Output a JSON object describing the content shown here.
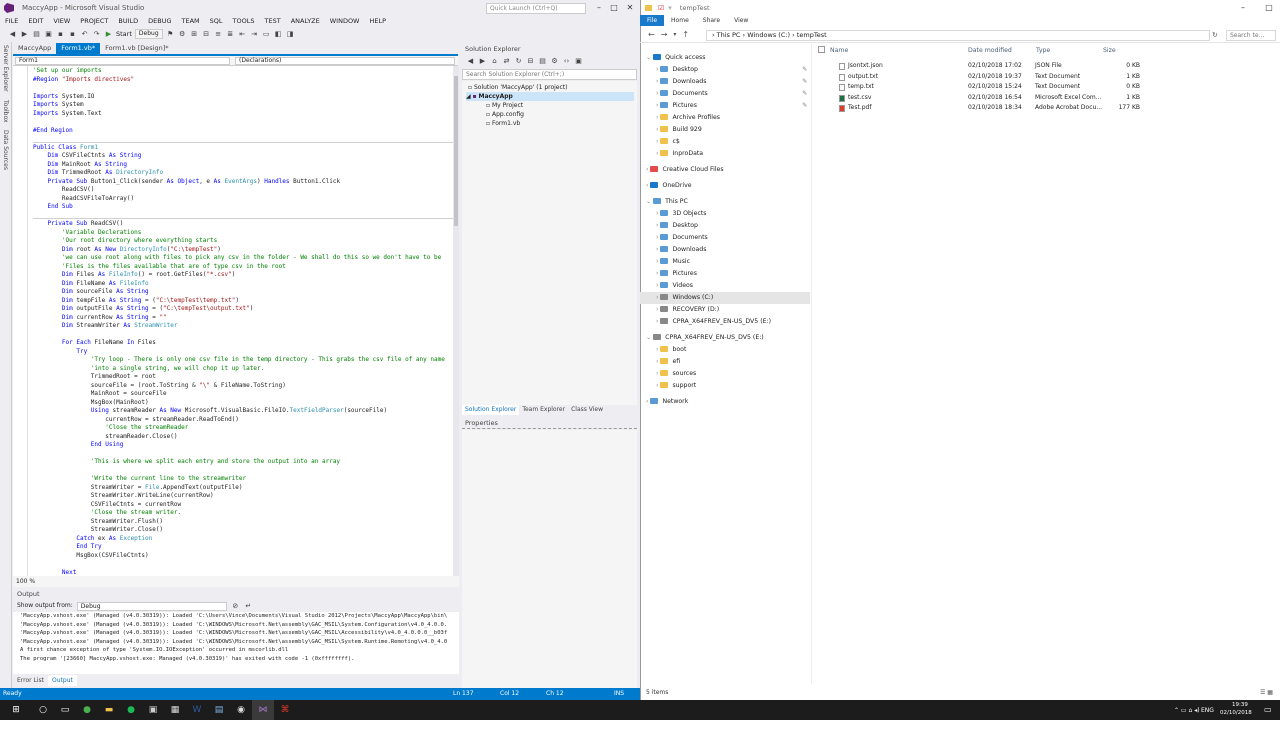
{
  "vs": {
    "title": "MaccyApp - Microsoft Visual Studio",
    "quick_launch_placeholder": "Quick Launch (Ctrl+Q)",
    "menu": [
      "FILE",
      "EDIT",
      "VIEW",
      "PROJECT",
      "BUILD",
      "DEBUG",
      "TEAM",
      "SQL",
      "TOOLS",
      "TEST",
      "ANALYZE",
      "WINDOW",
      "HELP"
    ],
    "toolbar": {
      "start": "Start",
      "config": "Debug"
    },
    "side_tabs": [
      "Server Explorer",
      "Toolbox",
      "Data Sources"
    ],
    "doc_tabs": [
      "MaccyApp",
      "Form1.vb*",
      "Form1.vb [Design]*"
    ],
    "nav_left": "Form1",
    "nav_right": "(Declarations)",
    "zoom": "100 %",
    "output": {
      "title": "Output",
      "show_from_label": "Show output from:",
      "show_from_value": "Debug",
      "lines": [
        "'MaccyApp.vshost.exe' (Managed (v4.0.30319)): Loaded 'C:\\Users\\Vince\\Documents\\Visual Studio 2012\\Projects\\MaccyApp\\MaccyApp\\bin\\",
        "'MaccyApp.vshost.exe' (Managed (v4.0.30319)): Loaded 'C:\\WINDOWS\\Microsoft.Net\\assembly\\GAC_MSIL\\System.Configuration\\v4.0_4.0.0.",
        "'MaccyApp.vshost.exe' (Managed (v4.0.30319)): Loaded 'C:\\WINDOWS\\Microsoft.Net\\assembly\\GAC_MSIL\\Accessibility\\v4.0_4.0.0.0__b03f",
        "'MaccyApp.vshost.exe' (Managed (v4.0.30319)): Loaded 'C:\\WINDOWS\\Microsoft.Net\\assembly\\GAC_MSIL\\System.Runtime.Remoting\\v4.0_4.0",
        "A first chance exception of type 'System.IO.IOException' occurred in mscorlib.dll",
        "The program '[23660] MaccyApp.vshost.exe: Managed (v4.0.30319)' has exited with code -1 (0xffffffff)."
      ]
    },
    "bottom_tabs": [
      "Error List",
      "Output"
    ],
    "solution_explorer": {
      "title": "Solution Explorer",
      "search_placeholder": "Search Solution Explorer (Ctrl+;)",
      "items": [
        "Solution 'MaccyApp' (1 project)",
        "MaccyApp",
        "My Project",
        "App.config",
        "Form1.vb"
      ],
      "tabs": [
        "Solution Explorer",
        "Team Explorer",
        "Class View"
      ]
    },
    "properties_title": "Properties",
    "status": {
      "ready": "Ready",
      "ln": "Ln 137",
      "col": "Col 12",
      "ch": "Ch 12",
      "ins": "INS"
    }
  },
  "code": [
    [
      [
        "cm",
        "'Set up our imports"
      ]
    ],
    [
      [
        "kw",
        "#Region "
      ],
      [
        "st",
        "\"Imports directives\""
      ]
    ],
    [],
    [
      [
        "kw",
        "Imports "
      ],
      [
        "",
        "System.IO"
      ]
    ],
    [
      [
        "kw",
        "Imports "
      ],
      [
        "",
        "System"
      ]
    ],
    [
      [
        "kw",
        "Imports "
      ],
      [
        "",
        "System.Text"
      ]
    ],
    [],
    [
      [
        "kw",
        "#End Region"
      ]
    ],
    [],
    [
      [
        "kw",
        "Public Class "
      ],
      [
        "ty",
        "Form1"
      ]
    ],
    [
      [
        "",
        "    "
      ],
      [
        "kw",
        "Dim "
      ],
      [
        "",
        "CSVFileCtnts "
      ],
      [
        "kw",
        "As String"
      ]
    ],
    [
      [
        "",
        "    "
      ],
      [
        "kw",
        "Dim "
      ],
      [
        "",
        "MainRoot "
      ],
      [
        "kw",
        "As String"
      ]
    ],
    [
      [
        "",
        "    "
      ],
      [
        "kw",
        "Dim "
      ],
      [
        "",
        "TrimmedRoot "
      ],
      [
        "kw",
        "As "
      ],
      [
        "ty",
        "DirectoryInfo"
      ]
    ],
    [
      [
        "",
        "    "
      ],
      [
        "kw",
        "Private Sub "
      ],
      [
        "",
        "Button1_Click(sender "
      ],
      [
        "kw",
        "As Object"
      ],
      [
        "",
        ", e "
      ],
      [
        "kw",
        "As "
      ],
      [
        "ty",
        "EventArgs"
      ],
      [
        "",
        ") "
      ],
      [
        "kw",
        "Handles "
      ],
      [
        "",
        "Button1.Click"
      ]
    ],
    [
      [
        "",
        "        ReadCSV()"
      ]
    ],
    [
      [
        "",
        "        ReadCSVFileToArray()"
      ]
    ],
    [
      [
        "",
        "    "
      ],
      [
        "kw",
        "End Sub"
      ]
    ],
    [],
    [
      [
        "",
        "    "
      ],
      [
        "kw",
        "Private Sub "
      ],
      [
        "",
        "ReadCSV()"
      ]
    ],
    [
      [
        "",
        "        "
      ],
      [
        "cm",
        "'Variable Declerations"
      ]
    ],
    [
      [
        "",
        "        "
      ],
      [
        "cm",
        "'Our root directory where everything starts"
      ]
    ],
    [
      [
        "",
        "        "
      ],
      [
        "kw",
        "Dim "
      ],
      [
        "",
        "root "
      ],
      [
        "kw",
        "As New "
      ],
      [
        "ty",
        "DirectoryInfo"
      ],
      [
        "",
        "("
      ],
      [
        "st",
        "\"C:\\tempTest\""
      ],
      [
        "",
        ")"
      ]
    ],
    [
      [
        "",
        "        "
      ],
      [
        "cm",
        "'we can use root along with files to pick any csv in the folder - We shall do this so we don't have to be"
      ]
    ],
    [
      [
        "",
        "        "
      ],
      [
        "cm",
        "'Files is the files available that are of type csv in the root"
      ]
    ],
    [
      [
        "",
        "        "
      ],
      [
        "kw",
        "Dim "
      ],
      [
        "",
        "Files "
      ],
      [
        "kw",
        "As "
      ],
      [
        "ty",
        "FileInfo"
      ],
      [
        "",
        "() = root.GetFiles("
      ],
      [
        "st",
        "\"*.csv\""
      ],
      [
        "",
        ")"
      ]
    ],
    [
      [
        "",
        "        "
      ],
      [
        "kw",
        "Dim "
      ],
      [
        "",
        "FileName "
      ],
      [
        "kw",
        "As "
      ],
      [
        "ty",
        "FileInfo"
      ]
    ],
    [
      [
        "",
        "        "
      ],
      [
        "kw",
        "Dim "
      ],
      [
        "",
        "sourceFile "
      ],
      [
        "kw",
        "As String"
      ]
    ],
    [
      [
        "",
        "        "
      ],
      [
        "kw",
        "Dim "
      ],
      [
        "",
        "tempFile "
      ],
      [
        "kw",
        "As String "
      ],
      [
        "",
        "= ("
      ],
      [
        "st",
        "\"C:\\tempTest\\temp.txt\""
      ],
      [
        "",
        ")"
      ]
    ],
    [
      [
        "",
        "        "
      ],
      [
        "kw",
        "Dim "
      ],
      [
        "",
        "outputFile "
      ],
      [
        "kw",
        "As String "
      ],
      [
        "",
        "= ("
      ],
      [
        "st",
        "\"C:\\tempTest\\output.txt\""
      ],
      [
        "",
        ")"
      ]
    ],
    [
      [
        "",
        "        "
      ],
      [
        "kw",
        "Dim "
      ],
      [
        "",
        "currentRow "
      ],
      [
        "kw",
        "As String "
      ],
      [
        "",
        "= "
      ],
      [
        "st",
        "\"\""
      ]
    ],
    [
      [
        "",
        "        "
      ],
      [
        "kw",
        "Dim "
      ],
      [
        "",
        "StreamWriter "
      ],
      [
        "kw",
        "As "
      ],
      [
        "ty",
        "StreamWriter"
      ]
    ],
    [],
    [
      [
        "",
        "        "
      ],
      [
        "kw",
        "For Each "
      ],
      [
        "",
        "FileName "
      ],
      [
        "kw",
        "In "
      ],
      [
        "",
        "Files"
      ]
    ],
    [
      [
        "",
        "            "
      ],
      [
        "kw",
        "Try"
      ]
    ],
    [
      [
        "",
        "                "
      ],
      [
        "cm",
        "'Try loop - There is only one csv file in the temp directory - This grabs the csv file of any name"
      ]
    ],
    [
      [
        "",
        "                "
      ],
      [
        "cm",
        "'into a single string, we will chop it up later."
      ]
    ],
    [
      [
        "",
        "                TrimmedRoot = root"
      ]
    ],
    [
      [
        "",
        "                sourceFile = (root.ToString & "
      ],
      [
        "st",
        "\"\\\""
      ],
      [
        "",
        " & FileName.ToString)"
      ]
    ],
    [
      [
        "",
        "                MainRoot = sourceFile"
      ]
    ],
    [
      [
        "",
        "                MsgBox(MainRoot)"
      ]
    ],
    [
      [
        "",
        "                "
      ],
      [
        "kw",
        "Using "
      ],
      [
        "",
        "streamReader "
      ],
      [
        "kw",
        "As New "
      ],
      [
        "",
        "Microsoft.VisualBasic.FileIO."
      ],
      [
        "ty",
        "TextFieldParser"
      ],
      [
        "",
        "(sourceFile)"
      ]
    ],
    [
      [
        "",
        "                    currentRow = streamReader.ReadToEnd()"
      ]
    ],
    [
      [
        "",
        "                    "
      ],
      [
        "cm",
        "'Close the streamReader"
      ]
    ],
    [
      [
        "",
        "                    streamReader.Close()"
      ]
    ],
    [
      [
        "",
        "                "
      ],
      [
        "kw",
        "End Using"
      ]
    ],
    [],
    [
      [
        "",
        "                "
      ],
      [
        "cm",
        "'This is where we split each entry and store the output into an array"
      ]
    ],
    [],
    [
      [
        "",
        "                "
      ],
      [
        "cm",
        "'Write the current line to the streamwriter"
      ]
    ],
    [
      [
        "",
        "                StreamWriter = "
      ],
      [
        "ty",
        "File"
      ],
      [
        "",
        ".AppendText(outputFile)"
      ]
    ],
    [
      [
        "",
        "                StreamWriter.WriteLine(currentRow)"
      ]
    ],
    [
      [
        "",
        "                CSVFileCtnts = currentRow"
      ]
    ],
    [
      [
        "",
        "                "
      ],
      [
        "cm",
        "'Close the stream writer."
      ]
    ],
    [
      [
        "",
        "                StreamWriter.Flush()"
      ]
    ],
    [
      [
        "",
        "                StreamWriter.Close()"
      ]
    ],
    [
      [
        "",
        "            "
      ],
      [
        "kw",
        "Catch "
      ],
      [
        "",
        "ex "
      ],
      [
        "kw",
        "As "
      ],
      [
        "ty",
        "Exception"
      ]
    ],
    [
      [
        "",
        "            "
      ],
      [
        "kw",
        "End Try"
      ]
    ],
    [
      [
        "",
        "            MsgBox(CSVFileCtnts)"
      ]
    ],
    [],
    [
      [
        "",
        "        "
      ],
      [
        "kw",
        "Next"
      ]
    ]
  ],
  "explorer": {
    "title": "tempTest",
    "ribbon": [
      "File",
      "Home",
      "Share",
      "View"
    ],
    "breadcrumb": "›  This PC  ›  Windows (C:)  ›  tempTest",
    "search_placeholder": "Search te...",
    "nav": [
      {
        "label": "Quick access",
        "level": 0,
        "icon": "star"
      },
      {
        "label": "Desktop",
        "level": 1,
        "icon": "folder-blue",
        "pin": true
      },
      {
        "label": "Downloads",
        "level": 1,
        "icon": "folder-blue",
        "pin": true
      },
      {
        "label": "Documents",
        "level": 1,
        "icon": "folder-blue",
        "pin": true
      },
      {
        "label": "Pictures",
        "level": 1,
        "icon": "folder-blue",
        "pin": true
      },
      {
        "label": "Archive Profiles",
        "level": 1,
        "icon": "folder"
      },
      {
        "label": "Build 929",
        "level": 1,
        "icon": "folder"
      },
      {
        "label": "c$",
        "level": 1,
        "icon": "folder"
      },
      {
        "label": "InproData",
        "level": 1,
        "icon": "folder"
      },
      {
        "label": "",
        "level": -1
      },
      {
        "label": "Creative Cloud Files",
        "level": 0,
        "icon": "cloud"
      },
      {
        "label": "",
        "level": -1
      },
      {
        "label": "OneDrive",
        "level": 0,
        "icon": "cloud-blue"
      },
      {
        "label": "",
        "level": -1
      },
      {
        "label": "This PC",
        "level": 0,
        "icon": "pc"
      },
      {
        "label": "3D Objects",
        "level": 1,
        "icon": "folder-blue"
      },
      {
        "label": "Desktop",
        "level": 1,
        "icon": "folder-blue"
      },
      {
        "label": "Documents",
        "level": 1,
        "icon": "folder-blue"
      },
      {
        "label": "Downloads",
        "level": 1,
        "icon": "folder-blue"
      },
      {
        "label": "Music",
        "level": 1,
        "icon": "folder-blue"
      },
      {
        "label": "Pictures",
        "level": 1,
        "icon": "folder-blue"
      },
      {
        "label": "Videos",
        "level": 1,
        "icon": "folder-blue"
      },
      {
        "label": "Windows (C:)",
        "level": 1,
        "icon": "drive",
        "selected": true
      },
      {
        "label": "RECOVERY (D:)",
        "level": 1,
        "icon": "drive"
      },
      {
        "label": "CPRA_X64FREV_EN-US_DV5 (E:)",
        "level": 1,
        "icon": "drive"
      },
      {
        "label": "",
        "level": -1
      },
      {
        "label": "CPRA_X64FREV_EN-US_DV5 (E:)",
        "level": 0,
        "icon": "drive"
      },
      {
        "label": "boot",
        "level": 1,
        "icon": "folder"
      },
      {
        "label": "efi",
        "level": 1,
        "icon": "folder"
      },
      {
        "label": "sources",
        "level": 1,
        "icon": "folder"
      },
      {
        "label": "support",
        "level": 1,
        "icon": "folder"
      },
      {
        "label": "",
        "level": -1
      },
      {
        "label": "Network",
        "level": 0,
        "icon": "network"
      }
    ],
    "columns": [
      "Name",
      "Date modified",
      "Type",
      "Size"
    ],
    "files": [
      {
        "name": "Jsontxt.json",
        "date": "02/10/2018 17:02",
        "type": "JSON File",
        "size": "0 KB",
        "icon": "doc"
      },
      {
        "name": "output.txt",
        "date": "02/10/2018 19:37",
        "type": "Text Document",
        "size": "1 KB",
        "icon": "doc"
      },
      {
        "name": "temp.txt",
        "date": "02/10/2018 15:24",
        "type": "Text Document",
        "size": "0 KB",
        "icon": "doc"
      },
      {
        "name": "test.csv",
        "date": "02/10/2018 16:54",
        "type": "Microsoft Excel Com...",
        "size": "1 KB",
        "icon": "excel"
      },
      {
        "name": "Test.pdf",
        "date": "02/10/2018 18:34",
        "type": "Adobe Acrobat Docu...",
        "size": "177 KB",
        "icon": "pdf"
      }
    ],
    "status": "5 items"
  },
  "taskbar": {
    "lang": "ENG",
    "time": "19:39",
    "date": "02/10/2018"
  },
  "colors": {
    "vs_accent": "#007acc",
    "vs_purple": "#68217a",
    "explorer_file": "#1979ca"
  }
}
